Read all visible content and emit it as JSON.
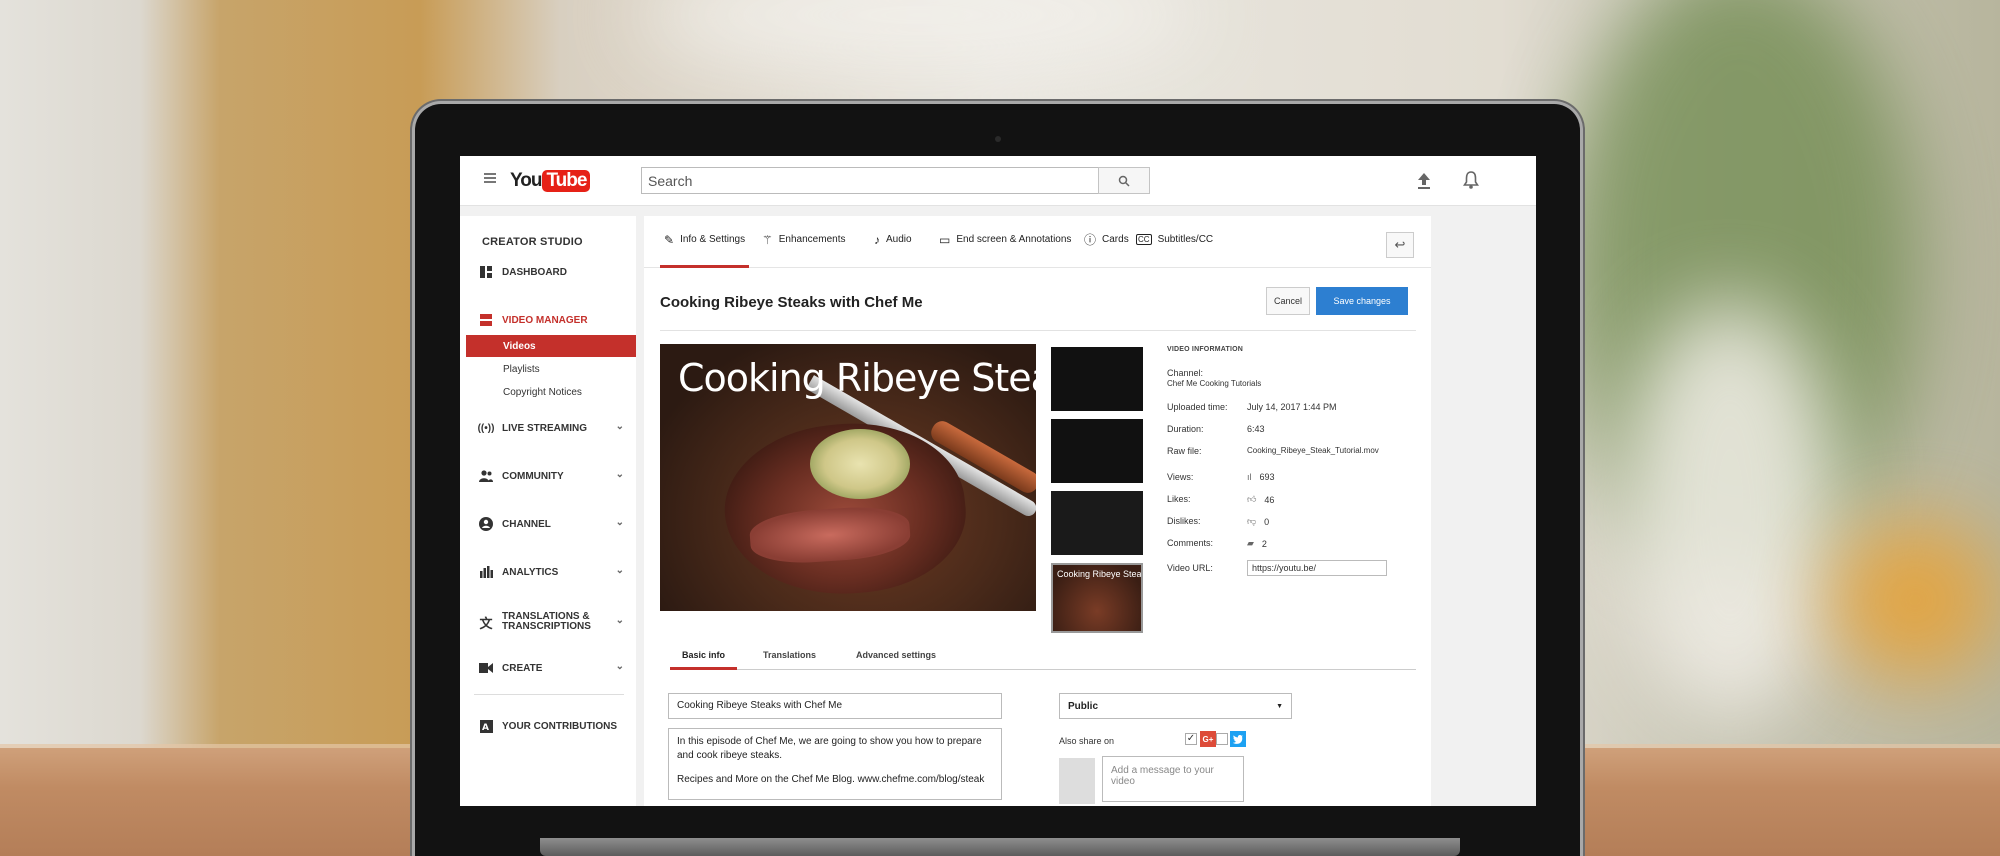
{
  "topbar": {
    "logo_you": "You",
    "logo_tube": "Tube",
    "search_placeholder": "Search"
  },
  "sidebar": {
    "title": "CREATOR STUDIO",
    "items": [
      {
        "label": "DASHBOARD"
      },
      {
        "label": "VIDEO MANAGER"
      },
      {
        "label": "LIVE STREAMING"
      },
      {
        "label": "COMMUNITY"
      },
      {
        "label": "CHANNEL"
      },
      {
        "label": "ANALYTICS"
      },
      {
        "label": "TRANSLATIONS &",
        "label2": "TRANSCRIPTIONS"
      },
      {
        "label": "CREATE"
      },
      {
        "label": "YOUR CONTRIBUTIONS"
      }
    ],
    "subitems": [
      {
        "label": "Videos"
      },
      {
        "label": "Playlists"
      },
      {
        "label": "Copyright Notices"
      }
    ]
  },
  "tabs": [
    {
      "label": "Info & Settings"
    },
    {
      "label": "Enhancements"
    },
    {
      "label": "Audio"
    },
    {
      "label": "End screen & Annotations"
    },
    {
      "label": "Cards"
    },
    {
      "label": "Subtitles/CC"
    }
  ],
  "video": {
    "title": "Cooking Ribeye Steaks with Chef Me",
    "thumbnail_text": "Cooking Ribeye Steaks",
    "cancel_label": "Cancel",
    "save_label": "Save changes"
  },
  "info": {
    "heading": "VIDEO INFORMATION",
    "channel_label": "Channel:",
    "channel_value": "Chef Me Cooking Tutorials",
    "uploaded_label": "Uploaded time:",
    "uploaded_value": "July 14, 2017 1:44 PM",
    "duration_label": "Duration:",
    "duration_value": "6:43",
    "raw_label": "Raw file:",
    "raw_value": "Cooking_Ribeye_Steak_Tutorial.mov",
    "views_label": "Views:",
    "views_value": "693",
    "likes_label": "Likes:",
    "likes_value": "46",
    "dislikes_label": "Dislikes:",
    "dislikes_value": "0",
    "comments_label": "Comments:",
    "comments_value": "2",
    "url_label": "Video URL:",
    "url_value": "https://youtu.be/"
  },
  "subtabs": [
    {
      "label": "Basic info"
    },
    {
      "label": "Translations"
    },
    {
      "label": "Advanced settings"
    }
  ],
  "form": {
    "title_value": "Cooking Ribeye Steaks with Chef Me",
    "description_line1": "In this episode of Chef Me, we are going to show you how to prepare",
    "description_line2": "and cook ribeye steaks.",
    "description_line3": "Recipes and More on the Chef Me Blog. www.chefme.com/blog/steak",
    "privacy_value": "Public",
    "share_label": "Also share on",
    "gplus_label": "G+",
    "message_placeholder": "Add a message to your video"
  },
  "colors": {
    "accent_red": "#c4302b",
    "save_blue": "#2d7fd1",
    "youtube_red": "#e62117",
    "twitter_blue": "#1da1f2",
    "gplus_red": "#dd4b39"
  }
}
